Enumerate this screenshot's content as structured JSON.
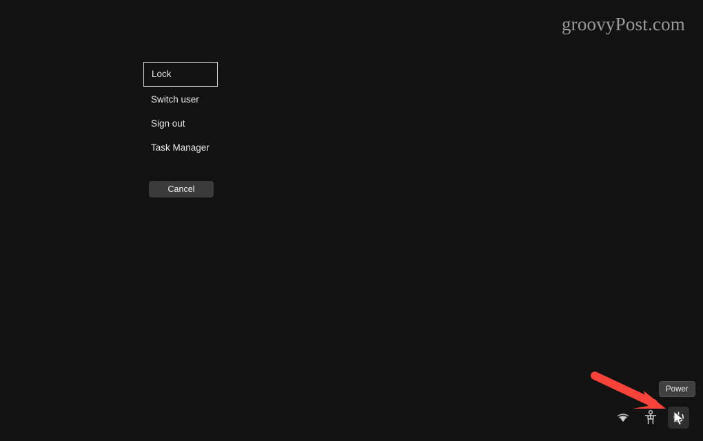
{
  "screen": {
    "background_color": "#121212",
    "description": "Windows security options screen (Ctrl+Alt+Del)"
  },
  "watermark": {
    "text": "groovyPost.com",
    "color": "#9a9a9a"
  },
  "options_menu": {
    "items": [
      {
        "label": "Lock",
        "name": "lock",
        "selected": true
      },
      {
        "label": "Switch user",
        "name": "switch-user",
        "selected": false
      },
      {
        "label": "Sign out",
        "name": "sign-out",
        "selected": false
      },
      {
        "label": "Task Manager",
        "name": "task-manager",
        "selected": false
      }
    ],
    "cancel_label": "Cancel"
  },
  "tray": {
    "wifi_icon": "wifi-icon",
    "accessibility_icon": "accessibility-icon",
    "power_icon": "power-icon",
    "power_tooltip": "Power"
  },
  "annotation": {
    "arrow_color": "#f9423a",
    "points_at": "power-button"
  },
  "cursor": {
    "type": "arrow-pointer",
    "color": "#ffffff"
  }
}
